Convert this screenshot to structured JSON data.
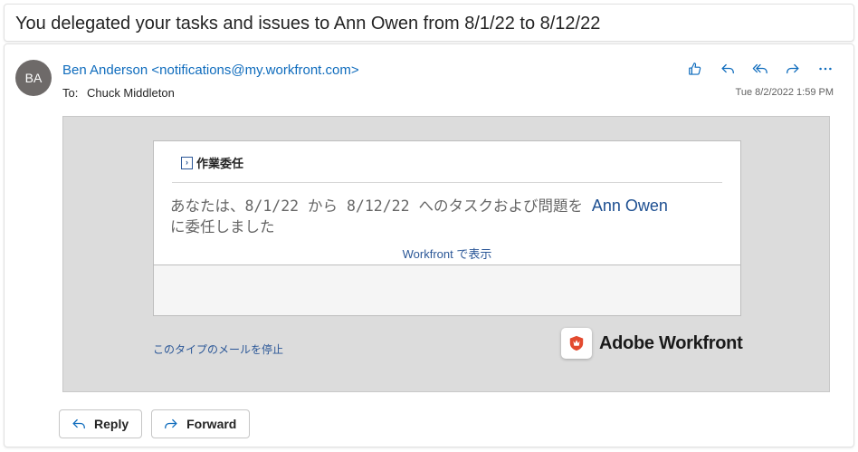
{
  "subject": "You delegated your tasks and issues to Ann Owen from 8/1/22 to 8/12/22",
  "header": {
    "avatar_initials": "BA",
    "sender": "Ben Anderson <notifications@my.workfront.com>",
    "to_label": "To:",
    "to_name": "Chuck Middleton",
    "timestamp": "Tue 8/2/2022 1:59 PM",
    "actions": [
      "like-icon",
      "reply-icon",
      "reply-all-icon",
      "forward-icon",
      "more-icon"
    ]
  },
  "email_body": {
    "card_title": "作業委任",
    "message_prefix": "あなたは、8/1/22 から 8/12/22 へのタスクおよび問題を ",
    "assignee": "Ann Owen",
    "message_suffix": "に委任しました",
    "view_link": "Workfront で表示",
    "stop_link": "このタイプのメールを停止",
    "brand_name": "Adobe Workfront"
  },
  "footer": {
    "reply_label": "Reply",
    "forward_label": "Forward"
  },
  "colors": {
    "link_blue": "#0f6cbd",
    "email_link": "#2b5797",
    "assignee": "#1d4f91",
    "brand_red": "#e34a2f"
  }
}
